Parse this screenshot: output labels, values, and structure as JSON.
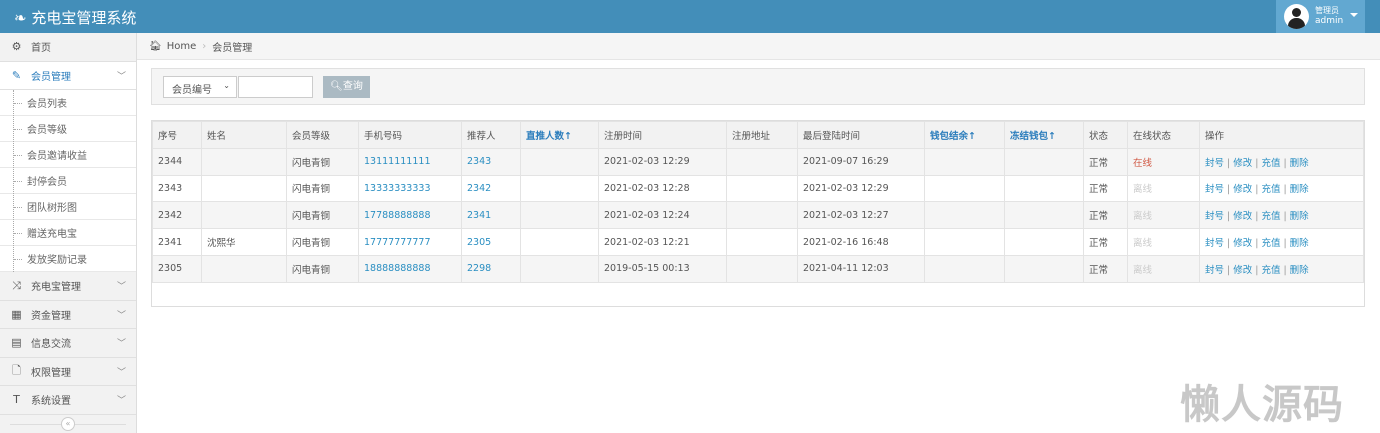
{
  "app": {
    "title": "充电宝管理系统"
  },
  "user": {
    "role": "管理员",
    "name": "admin"
  },
  "sidebar": {
    "items": [
      {
        "label": "首页",
        "icon": "dashboard-icon"
      },
      {
        "label": "会员管理",
        "icon": "edit-icon"
      },
      {
        "label": "充电宝管理",
        "icon": "random-icon"
      },
      {
        "label": "资金管理",
        "icon": "calendar-icon"
      },
      {
        "label": "信息交流",
        "icon": "list-icon"
      },
      {
        "label": "权限管理",
        "icon": "file-icon"
      },
      {
        "label": "系统设置",
        "icon": "text-icon"
      }
    ],
    "sub": [
      "会员列表",
      "会员等级",
      "会员邀请收益",
      "封停会员",
      "团队树形图",
      "赠送充电宝",
      "发放奖励记录"
    ]
  },
  "breadcrumb": {
    "home": "Home",
    "current": "会员管理"
  },
  "search": {
    "select": "会员编号",
    "input": "",
    "button": "查询"
  },
  "table": {
    "headers": [
      "序号",
      "姓名",
      "会员等级",
      "手机号码",
      "推荐人",
      "直推人数↑",
      "注册时间",
      "注册地址",
      "最后登陆时间",
      "钱包结余↑",
      "冻结钱包↑",
      "状态",
      "在线状态",
      "操作"
    ],
    "rows": [
      {
        "id": "2344",
        "name": "",
        "level": "闪电青铜",
        "phone": "13111111111",
        "ref": "2343",
        "direct": "",
        "reg": "2021-02-03 12:29",
        "addr": "",
        "last": "2021-09-07 16:29",
        "wallet": "",
        "frozen": "",
        "status": "正常",
        "online": "在线"
      },
      {
        "id": "2343",
        "name": "",
        "level": "闪电青铜",
        "phone": "13333333333",
        "ref": "2342",
        "direct": "",
        "reg": "2021-02-03 12:28",
        "addr": "",
        "last": "2021-02-03 12:29",
        "wallet": "",
        "frozen": "",
        "status": "正常",
        "online": "离线"
      },
      {
        "id": "2342",
        "name": "",
        "level": "闪电青铜",
        "phone": "17788888888",
        "ref": "2341",
        "direct": "",
        "reg": "2021-02-03 12:24",
        "addr": "",
        "last": "2021-02-03 12:27",
        "wallet": "",
        "frozen": "",
        "status": "正常",
        "online": "离线"
      },
      {
        "id": "2341",
        "name": "沈熙华",
        "level": "闪电青铜",
        "phone": "17777777777",
        "ref": "2305",
        "direct": "",
        "reg": "2021-02-03 12:21",
        "addr": "",
        "last": "2021-02-16 16:48",
        "wallet": "",
        "frozen": "",
        "status": "正常",
        "online": "离线"
      },
      {
        "id": "2305",
        "name": "",
        "level": "闪电青铜",
        "phone": "18888888888",
        "ref": "2298",
        "direct": "",
        "reg": "2019-05-15 00:13",
        "addr": "",
        "last": "2021-04-11 12:03",
        "wallet": "",
        "frozen": "",
        "status": "正常",
        "online": "离线"
      }
    ],
    "actions": [
      "封号",
      "修改",
      "充值",
      "删除"
    ]
  },
  "watermark": "懒人源码",
  "colors": {
    "topbar": "#438eb9",
    "link": "#2b8fc2",
    "online": "#d15b47"
  }
}
